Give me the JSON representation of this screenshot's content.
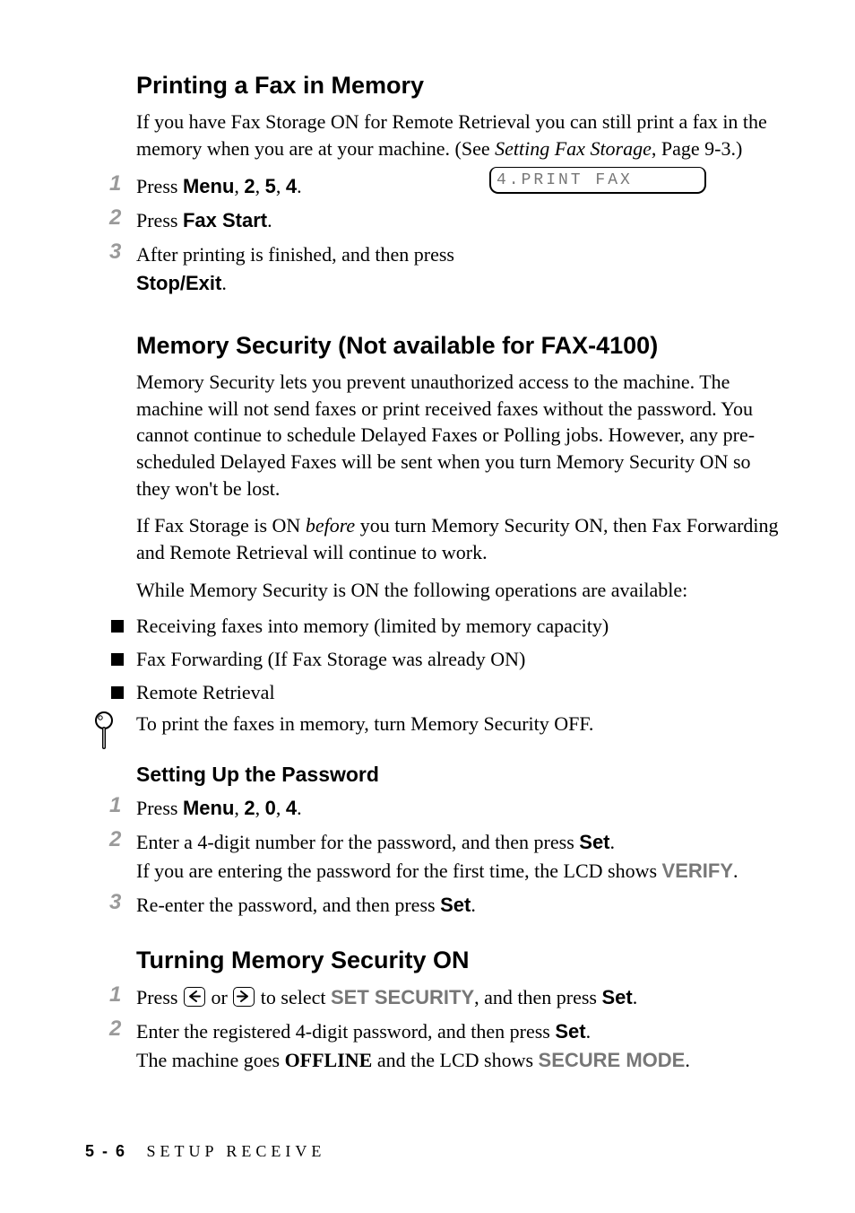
{
  "sections": {
    "printFax": {
      "title": "Printing a Fax in Memory",
      "intro_a": "If you have Fax Storage ON for Remote Retrieval you can still print a fax in the memory when you are at your machine. (See ",
      "intro_link": "Setting Fax Storage",
      "intro_b": ", Page 9-3.)",
      "steps": {
        "s1_a": "Press ",
        "s1_menu": "Menu",
        "s1_b": ", ",
        "s1_k1": "2",
        "s1_c": ", ",
        "s1_k2": "5",
        "s1_d": ", ",
        "s1_k3": "4",
        "s1_e": ".",
        "s2_a": "Press ",
        "s2_btn": "Fax Start",
        "s2_b": ".",
        "s3_a": "After printing is finished, and then press ",
        "s3_btn": "Stop/Exit",
        "s3_b": "."
      },
      "lcd": "4.PRINT FAX"
    },
    "memSec": {
      "title": "Memory Security (Not available for FAX-4100)",
      "p1": "Memory Security lets you prevent unauthorized access to the machine. The machine will not send faxes or print received faxes without the password. You cannot continue to schedule Delayed Faxes or Polling jobs. However, any pre-scheduled Delayed Faxes will be sent when you turn Memory Security ON so they won't be lost.",
      "p2_a": "If Fax Storage is ON ",
      "p2_em": "before",
      "p2_b": " you turn Memory Security ON, then Fax Forwarding and Remote Retrieval will continue to work.",
      "p3": "While Memory Security is ON the following operations are available:",
      "bullets": [
        "Receiving faxes into memory (limited by memory capacity)",
        "Fax Forwarding (If Fax Storage was already ON)",
        "Remote Retrieval"
      ],
      "note": "To print the faxes in memory, turn Memory Security OFF."
    },
    "setPw": {
      "title": "Setting Up the Password",
      "s1_a": "Press ",
      "s1_menu": "Menu",
      "s1_b": ", ",
      "s1_k1": "2",
      "s1_c": ", ",
      "s1_k2": "0",
      "s1_d": ", ",
      "s1_k3": "4",
      "s1_e": ".",
      "s2_a": "Enter a 4-digit number for the password, and then press ",
      "s2_btn": "Set",
      "s2_b": ".",
      "s2_c": "If you are entering the password for the first time, the LCD shows ",
      "s2_disp": "VERIFY",
      "s2_d": ".",
      "s3_a": "Re-enter the password, and then press ",
      "s3_btn": "Set",
      "s3_b": "."
    },
    "turnOn": {
      "title": "Turning Memory Security ON",
      "s1_a": "Press ",
      "s1_b": " or ",
      "s1_c": " to select ",
      "s1_disp": "SET SECURITY",
      "s1_d": ", and then press ",
      "s1_btn": "Set",
      "s1_e": ".",
      "s2_a": "Enter the registered 4-digit password, and then press ",
      "s2_btn": "Set",
      "s2_b": ".",
      "s2_c": "The machine goes ",
      "s2_off": "OFFLINE",
      "s2_d": " and the LCD shows ",
      "s2_disp": "SECURE MODE",
      "s2_e": "."
    }
  },
  "footer": {
    "page": "5 - 6",
    "chapter": "SETUP RECEIVE"
  },
  "nums": [
    "1",
    "2",
    "3"
  ]
}
